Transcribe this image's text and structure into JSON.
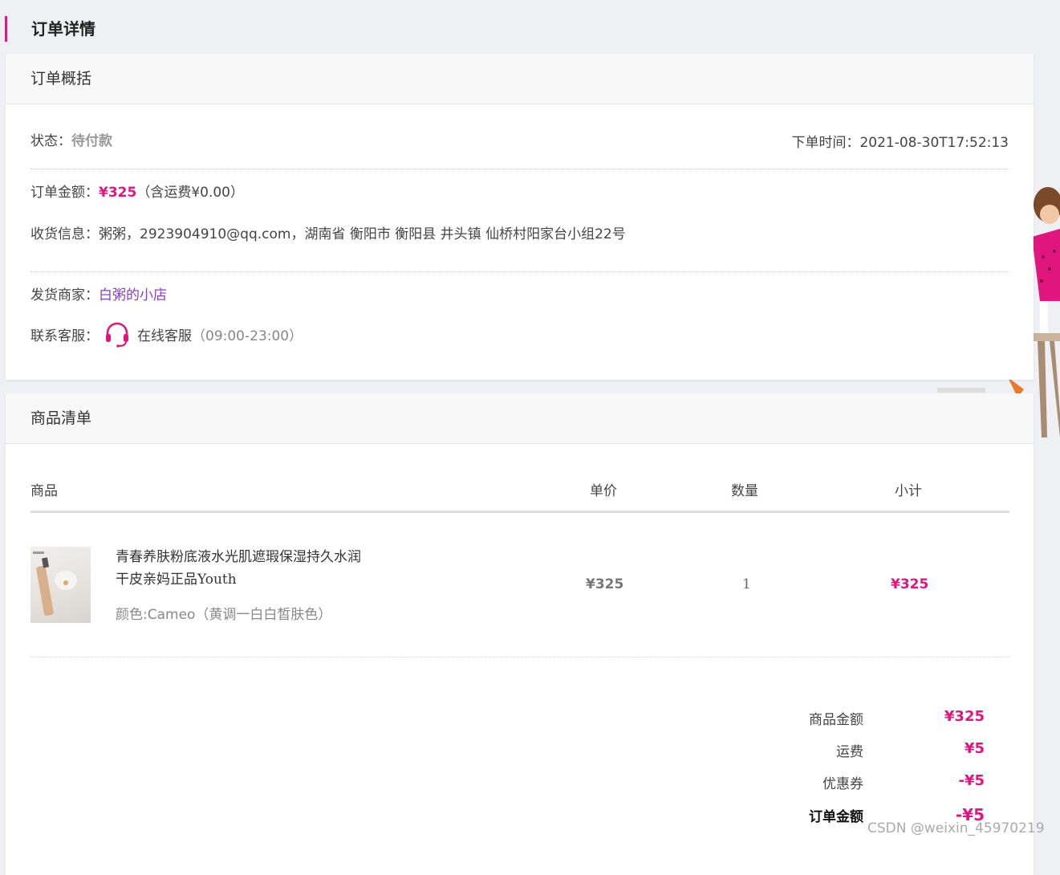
{
  "page_title": "订单详情",
  "overview": {
    "title": "订单概括",
    "status_label": "状态：",
    "status_value": "待付款",
    "order_time_label": "下单时间：",
    "order_time_value": "2021-08-30T17:52:13",
    "amount_label": "订单金额：",
    "amount_value": "¥325",
    "amount_note": "（含运费¥0.00）",
    "shipping_label": "收货信息：",
    "shipping_value": "粥粥，2923904910@qq.com，湖南省 衡阳市 衡阳县 井头镇 仙桥村阳家台小组22号",
    "seller_label": "发货商家：",
    "seller_value": "白粥的小店",
    "service_label": "联系客服：",
    "service_icon": "headset-icon",
    "service_text": "在线客服",
    "service_hours": "（09:00-23:00）"
  },
  "goods": {
    "title": "商品清单",
    "columns": {
      "product": "商品",
      "unit_price": "单价",
      "quantity": "数量",
      "subtotal": "小计"
    },
    "items": [
      {
        "name": "青春养肤粉底液水光肌遮瑕保湿持久水润干皮亲妈正品Youth",
        "attr": "颜色:Cameo（黄调一白白皙肤色）",
        "unit_price": "¥325",
        "quantity": "1",
        "subtotal": "¥325"
      }
    ],
    "summary": {
      "goods_amount_label": "商品金额",
      "goods_amount_value": "¥325",
      "freight_label": "运费",
      "freight_value": "¥5",
      "coupon_label": "优惠券",
      "coupon_value": "-¥5",
      "total_label": "订单金额",
      "total_value": "-¥5"
    }
  },
  "colors": {
    "accent": "#e0167f",
    "link": "#8a3bd1"
  },
  "watermark": "CSDN @weixin_45970219"
}
